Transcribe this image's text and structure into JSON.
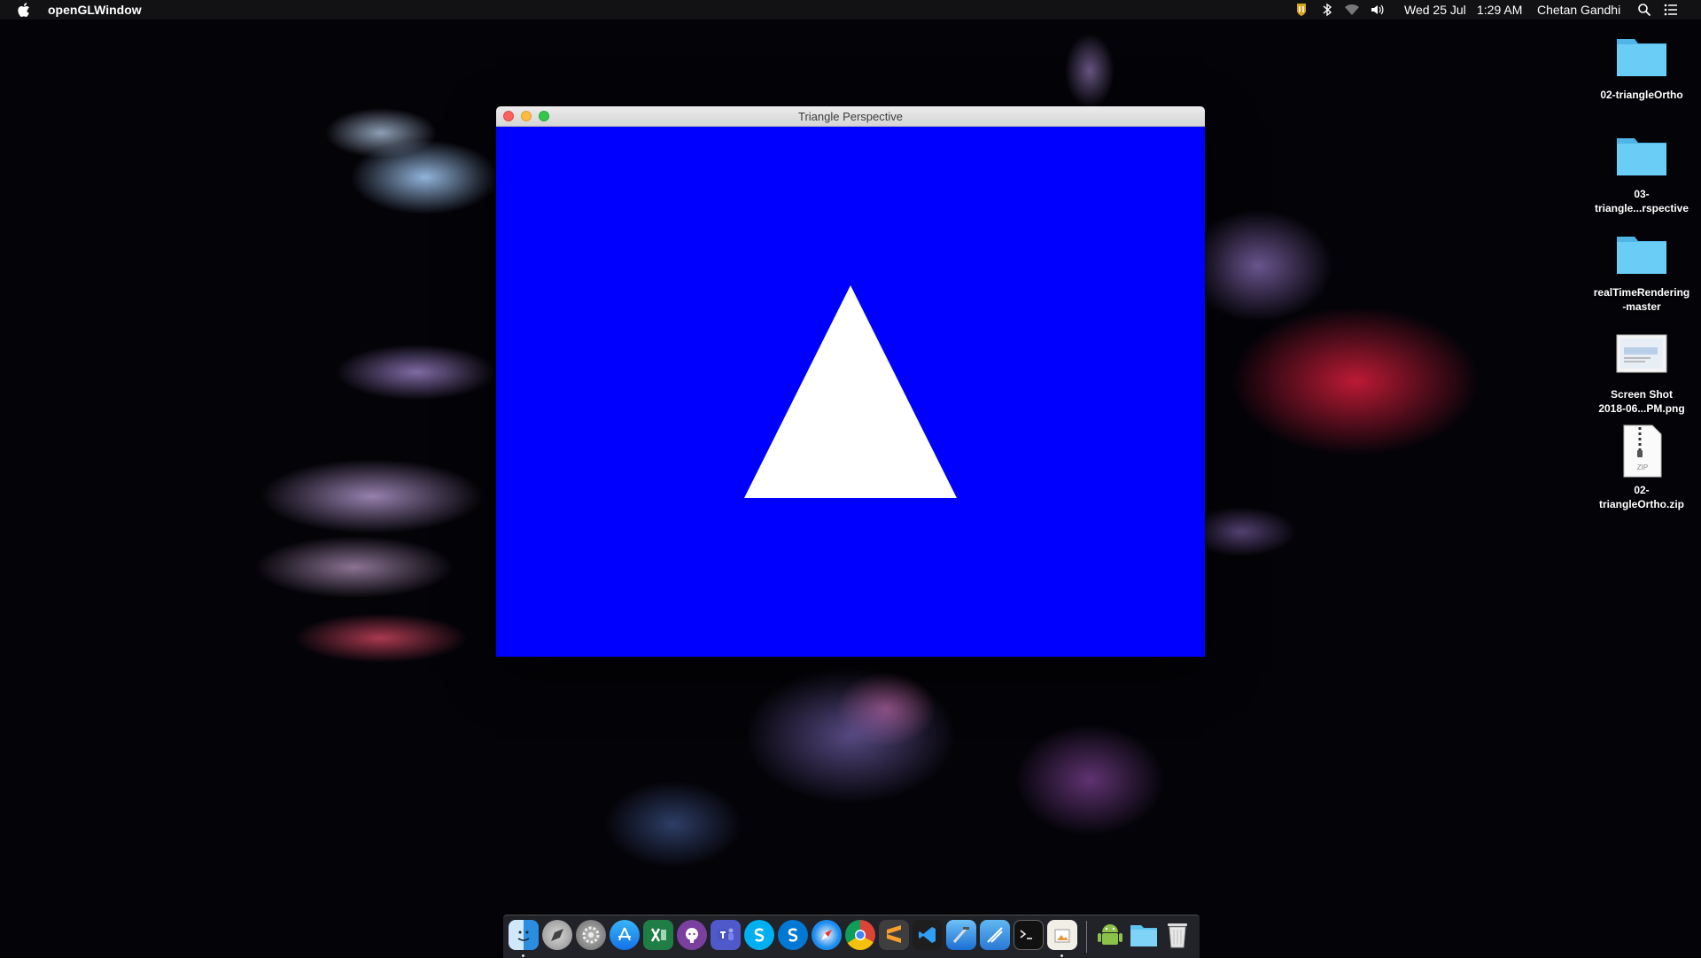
{
  "menubar": {
    "app_name": "openGLWindow",
    "date": "Wed 25 Jul",
    "time": "1:29 AM",
    "user": "Chetan Gandhi",
    "icons": [
      "norton-icon",
      "bluetooth-icon",
      "wifi-icon",
      "volume-icon",
      "spotlight-icon",
      "notification-center-icon"
    ]
  },
  "window": {
    "title": "Triangle Perspective",
    "background_color": "#0000ff",
    "triangle_color": "#ffffff"
  },
  "desktop": {
    "items": [
      {
        "label": "02-triangleOrtho",
        "kind": "folder"
      },
      {
        "label": "03-\ntriangle...rspective",
        "kind": "folder"
      },
      {
        "label": "realTimeRendering\n-master",
        "kind": "folder"
      },
      {
        "label": "Screen Shot\n2018-06...PM.png",
        "kind": "image"
      },
      {
        "label": "02-\ntriangleOrtho.zip",
        "kind": "zip",
        "badge": "ZIP"
      }
    ]
  },
  "dock": {
    "apps": [
      "finder",
      "launchpad",
      "system-preferences",
      "app-store",
      "excel",
      "github-desktop",
      "teams",
      "skype",
      "skype-for-business",
      "safari",
      "chrome",
      "sublime-text",
      "visual-studio-code",
      "xcode",
      "instruments",
      "terminal",
      "preview",
      "android-file-transfer",
      "downloads-folder",
      "trash"
    ]
  },
  "colors": {
    "folder": "#5ec3ef",
    "window_blue": "#0000ff"
  }
}
